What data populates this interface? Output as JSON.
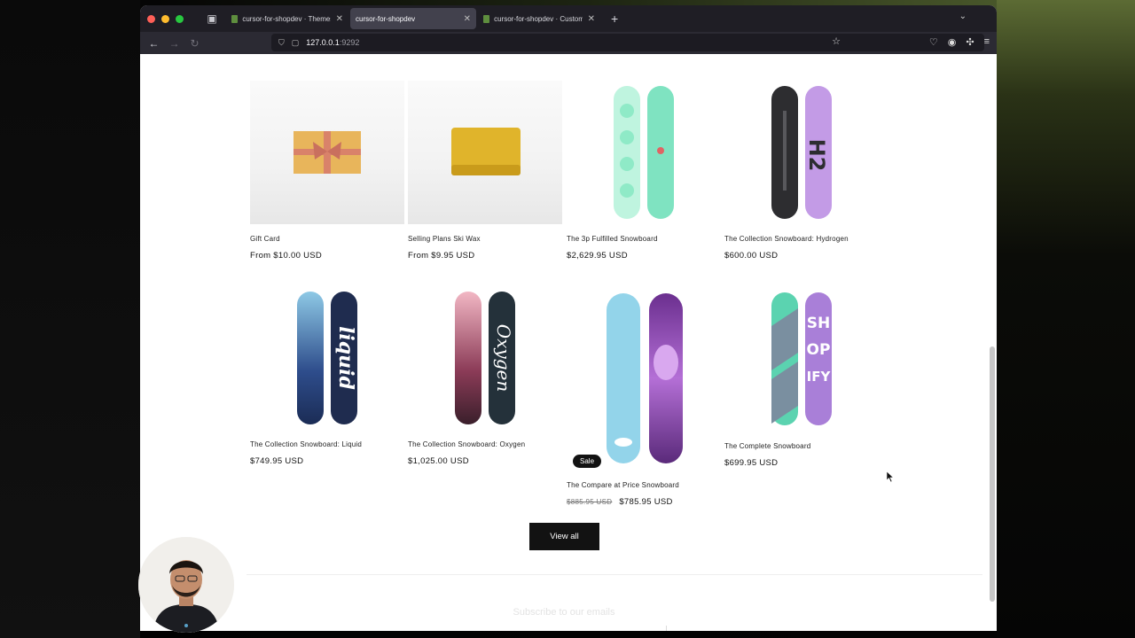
{
  "browser": {
    "tabs": [
      {
        "label": "cursor-for-shopdev · Themes ·",
        "active": false
      },
      {
        "label": "cursor-for-shopdev",
        "active": true
      },
      {
        "label": "cursor-for-shopdev · Customize",
        "active": false
      }
    ],
    "url_host": "127.0.0.1",
    "url_port": ":9292"
  },
  "products": [
    {
      "title": "Gift Card",
      "price": "From $10.00 USD"
    },
    {
      "title": "Selling Plans Ski Wax",
      "price": "From $9.95 USD"
    },
    {
      "title": "The 3p Fulfilled Snowboard",
      "price": "$2,629.95 USD"
    },
    {
      "title": "The Collection Snowboard: Hydrogen",
      "price": "$600.00 USD"
    },
    {
      "title": "The Collection Snowboard: Liquid",
      "price": "$749.95 USD"
    },
    {
      "title": "The Collection Snowboard: Oxygen",
      "price": "$1,025.00 USD"
    },
    {
      "title": "The Compare at Price Snowboard",
      "price": "$785.95 USD",
      "compare_price": "$885.95 USD",
      "badge": "Sale"
    },
    {
      "title": "The Complete Snowboard",
      "price": "$699.95 USD"
    }
  ],
  "board_text": {
    "liquid": "liquid",
    "oxygen": "Oxygen",
    "hydrogen": "H2",
    "complete": [
      "SH",
      "OP",
      "IFY"
    ]
  },
  "view_all_label": "View all",
  "newsletter_heading": "Subscribe to our emails",
  "colors": {
    "button_bg": "#121212",
    "browser_chrome": "#1f1e25",
    "tab_active": "#42414d"
  }
}
